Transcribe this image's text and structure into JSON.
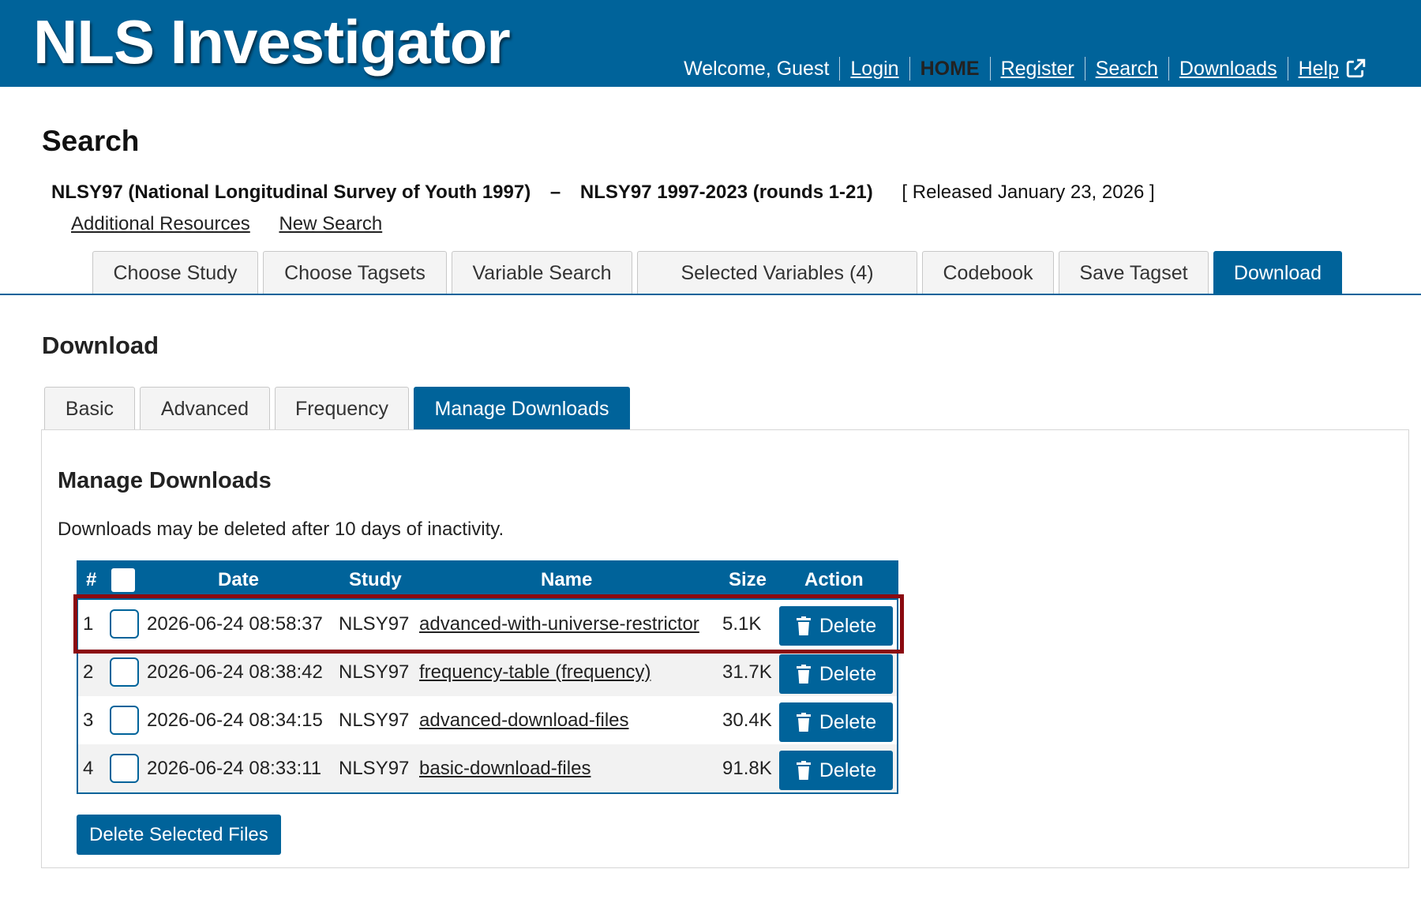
{
  "header": {
    "logo": "NLS Investigator",
    "welcome": "Welcome, Guest",
    "nav": {
      "login": "Login",
      "home": "HOME",
      "register": "Register",
      "search": "Search",
      "downloads": "Downloads",
      "help": "Help"
    },
    "bg_color": "#00639a"
  },
  "page": {
    "title": "Search",
    "study_name": "NLSY97 (National Longitudinal Survey of Youth 1997)",
    "dash": "–",
    "study_version": "NLSY97 1997-2023 (rounds 1-21)",
    "released": "[ Released January 23, 2026 ]",
    "links": {
      "additional_resources": "Additional Resources",
      "new_search": "New Search"
    }
  },
  "main_tabs": [
    {
      "label": "Choose Study",
      "active": false
    },
    {
      "label": "Choose Tagsets",
      "active": false
    },
    {
      "label": "Variable Search",
      "active": false
    },
    {
      "label": "Selected Variables (4)",
      "active": false
    },
    {
      "label": "Codebook",
      "active": false
    },
    {
      "label": "Save Tagset",
      "active": false
    },
    {
      "label": "Download",
      "active": true
    }
  ],
  "download": {
    "section_title": "Download",
    "sub_tabs": [
      {
        "label": "Basic",
        "active": false
      },
      {
        "label": "Advanced",
        "active": false
      },
      {
        "label": "Frequency",
        "active": false
      },
      {
        "label": "Manage Downloads",
        "active": true
      }
    ],
    "panel_title": "Manage Downloads",
    "note": "Downloads may be deleted after 10 days of inactivity.",
    "table": {
      "headers": {
        "num": "#",
        "date": "Date",
        "study": "Study",
        "name": "Name",
        "size": "Size",
        "action": "Action"
      },
      "rows": [
        {
          "num": "1",
          "date": "2026-06-24 08:58:37",
          "study": "NLSY97",
          "name": "advanced-with-universe-restrictor",
          "size": "5.1K",
          "action": "Delete",
          "highlighted": true
        },
        {
          "num": "2",
          "date": "2026-06-24 08:38:42",
          "study": "NLSY97",
          "name": "frequency-table (frequency)",
          "size": "31.7K",
          "action": "Delete"
        },
        {
          "num": "3",
          "date": "2026-06-24 08:34:15",
          "study": "NLSY97",
          "name": "advanced-download-files",
          "size": "30.4K",
          "action": "Delete"
        },
        {
          "num": "4",
          "date": "2026-06-24 08:33:11",
          "study": "NLSY97",
          "name": "basic-download-files",
          "size": "91.8K",
          "action": "Delete"
        }
      ]
    },
    "delete_selected": "Delete Selected Files",
    "highlight_color": "#8b0a10"
  }
}
